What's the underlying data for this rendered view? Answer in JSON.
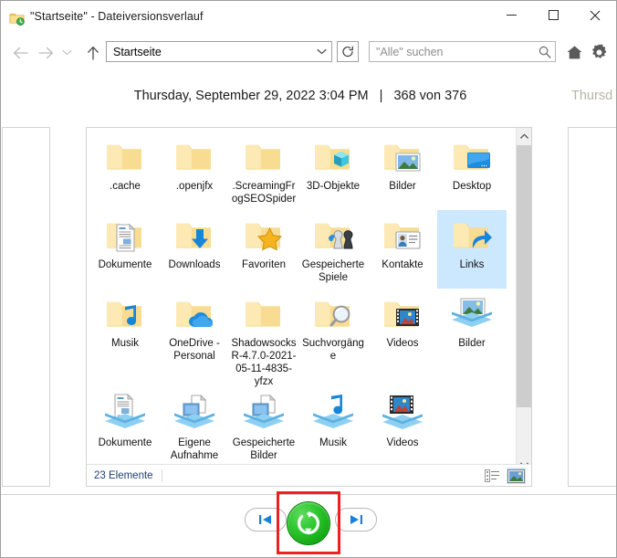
{
  "window": {
    "title": "\"Startseite\" - Dateiversionsverlauf",
    "app_icon": "folder-history-icon",
    "minimize_label": "—",
    "maximize_label": "□",
    "close_label": "✕"
  },
  "navbar": {
    "back_icon": "arrow-left-icon",
    "forward_icon": "arrow-right-icon",
    "recent_icon": "chevron-down-icon",
    "up_icon": "arrow-up-icon",
    "address_value": "Startseite",
    "address_chevron": "chevron-down-icon",
    "refresh_icon": "refresh-icon",
    "search_placeholder": "\"Alle\" suchen",
    "search_icon": "search-icon",
    "home_icon": "home-icon",
    "settings_icon": "gear-icon"
  },
  "version_header": {
    "timestamp": "Thursday, September 29, 2022 3:04 PM",
    "separator": "|",
    "position": "368 von 376",
    "next_version_faded": "Thursd"
  },
  "status": {
    "item_count": "23 Elemente",
    "view_details_icon": "details-view-icon",
    "view_thumbs_icon": "large-icons-view-icon"
  },
  "scrollbar": {
    "up_icon": "chevron-up-icon",
    "down_icon": "chevron-down-icon"
  },
  "bottom_controls": {
    "prev_label": "previous-version-icon",
    "next_label": "next-version-icon",
    "restore_label": "restore-icon",
    "highlight_color": "#f02020",
    "restore_color": "#2cc52c"
  },
  "files": [
    {
      "name": ".cache",
      "icon": "folder",
      "selected": false
    },
    {
      "name": ".openjfx",
      "icon": "folder",
      "selected": false
    },
    {
      "name": ".ScreamingFrogSEOSpider",
      "icon": "folder",
      "selected": false
    },
    {
      "name": "3D-Objekte",
      "icon": "folder-3d",
      "selected": false
    },
    {
      "name": "Bilder",
      "icon": "folder-pictures",
      "selected": false
    },
    {
      "name": "Desktop",
      "icon": "folder-desktop",
      "selected": false
    },
    {
      "name": "Dokumente",
      "icon": "folder-documents",
      "selected": false
    },
    {
      "name": "Downloads",
      "icon": "folder-downloads",
      "selected": false
    },
    {
      "name": "Favoriten",
      "icon": "folder-favorites",
      "selected": false
    },
    {
      "name": "Gespeicherte Spiele",
      "icon": "folder-games",
      "selected": false
    },
    {
      "name": "Kontakte",
      "icon": "folder-contacts",
      "selected": false
    },
    {
      "name": "Links",
      "icon": "folder-links",
      "selected": true
    },
    {
      "name": "Musik",
      "icon": "folder-music",
      "selected": false
    },
    {
      "name": "OneDrive - Personal",
      "icon": "folder-onedrive",
      "selected": false
    },
    {
      "name": "ShadowsocksR-4.7.0-2021-05-11-4835-yfzx",
      "icon": "folder",
      "selected": false
    },
    {
      "name": "Suchvorgänge",
      "icon": "folder-search",
      "selected": false
    },
    {
      "name": "Videos",
      "icon": "folder-videos",
      "selected": false
    },
    {
      "name": "Bilder",
      "icon": "library-pictures",
      "selected": false
    },
    {
      "name": "Dokumente",
      "icon": "library-documents",
      "selected": false
    },
    {
      "name": "Eigene Aufnahme",
      "icon": "library-captures",
      "selected": false
    },
    {
      "name": "Gespeicherte Bilder",
      "icon": "library-saved",
      "selected": false
    },
    {
      "name": "Musik",
      "icon": "library-music",
      "selected": false
    },
    {
      "name": "Videos",
      "icon": "library-videos",
      "selected": false
    }
  ]
}
